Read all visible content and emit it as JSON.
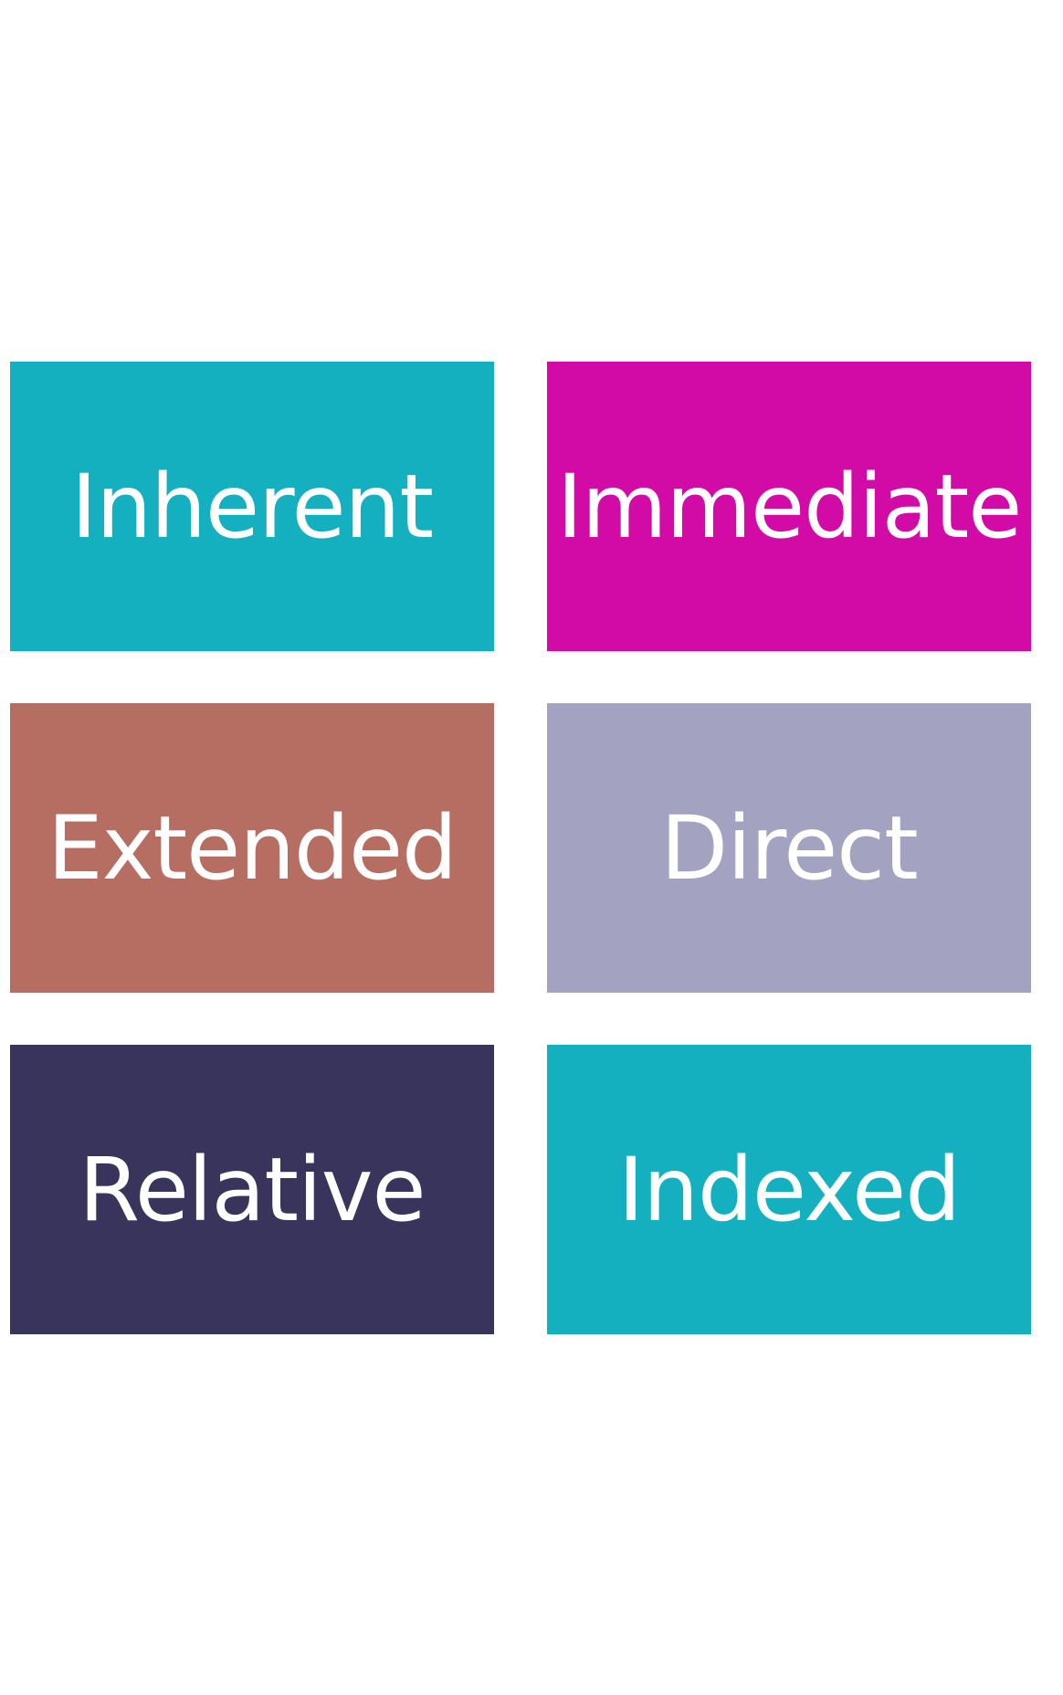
{
  "tiles": [
    {
      "label": "Inherent",
      "color": "#14b0bf"
    },
    {
      "label": "Immediate",
      "color": "#d20ba6"
    },
    {
      "label": "Extended",
      "color": "#b76e62"
    },
    {
      "label": "Direct",
      "color": "#a3a3c1"
    },
    {
      "label": "Relative",
      "color": "#38345c"
    },
    {
      "label": "Indexed",
      "color": "#14b0bf"
    }
  ]
}
